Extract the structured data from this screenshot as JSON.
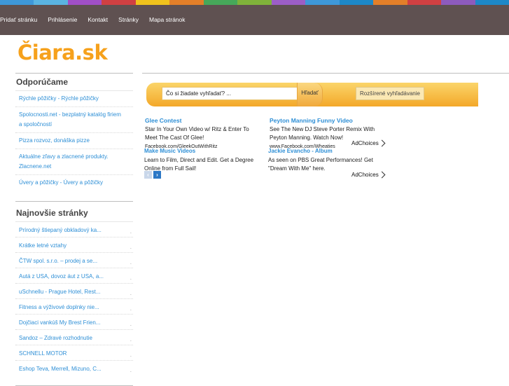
{
  "colors": {
    "strip": [
      "#3e98d9",
      "#5ab4e2",
      "#a04fc6",
      "#d04042",
      "#f0c21c",
      "#e37f29",
      "#46a85a",
      "#7fb23a",
      "#9c5ec6",
      "#3e98d9",
      "#1d88c8",
      "#e37f29",
      "#d04042",
      "#8d5bbd",
      "#1d88c8"
    ],
    "topbar": "#5f5151",
    "logo": "#f6a11c",
    "link": "#2e8fd6"
  },
  "topnav": {
    "items": [
      "Pridať stránku",
      "Prihlásenie",
      "Kontakt",
      "Stránky",
      "Mapa stránok"
    ]
  },
  "logo": {
    "text": "Čiara.sk"
  },
  "sidebar": {
    "recommended_title": "Odporúčame",
    "recommended": [
      "Rýchle pôžičky - Rýchle pôžičky",
      "Spolocnosti.net - bezplatný katalóg firiem a spoločností",
      "Pizza rozvoz, donáška pizze",
      "Aktuálne zľavy a zlacnené produkty. Zlacnene.net",
      "Úvery a pôžičky - Úvery a pôžičky"
    ],
    "newest_title": "Najnovšie stránky",
    "newest": [
      "Prírodný štiepaný obkladový ka...",
      "Krátke letné vztahy",
      "ČTW spol. s.r.o. – prodej a se...",
      "Autá z USA, dovoz áut z USA, a...",
      "uSchnellu - Prague Hotel, Rest...",
      "Fitness a výživové doplnky nie...",
      "Dojčiaci vankúš My Brest Frien...",
      "Sandoz – Zdravé rozhodnutie",
      "SCHNELL MOTOR",
      "Eshop Teva, Merrell, Mizuno, C..."
    ],
    "dot": "."
  },
  "search": {
    "value": "Čo si žiadate vyhľadať? ...",
    "button": "Hľadať",
    "advanced": "Rozšírené vyhľadávanie"
  },
  "ads": {
    "ad1": {
      "title": "Glee Contest",
      "line1": "Star In Your Own Video w/ Ritz & Enter To",
      "line2": "Meet The Cast Of Glee!",
      "url": "Facebook.com/GleekOutWithRitz"
    },
    "ad2": {
      "title": "Peyton Manning Funny Video",
      "line1": "See The New DJ Steve Porter Remix With",
      "line2": "Peyton Manning. Watch Now!",
      "url": "www.Facebook.com/Wheaties"
    },
    "ad3": {
      "title": "Make Music Videos",
      "line1": "Learn to Film, Direct and Edit. Get a Degree",
      "line2": "Online from Full Sail!"
    },
    "ad4": {
      "title": "Jackie Evancho - Album",
      "line1": "As seen on PBS Great Performances! Get",
      "line2": "\"Dream With Me\" here."
    },
    "adchoices": "AdChoices"
  },
  "pager": {
    "prev": "‹",
    "next": "›"
  }
}
